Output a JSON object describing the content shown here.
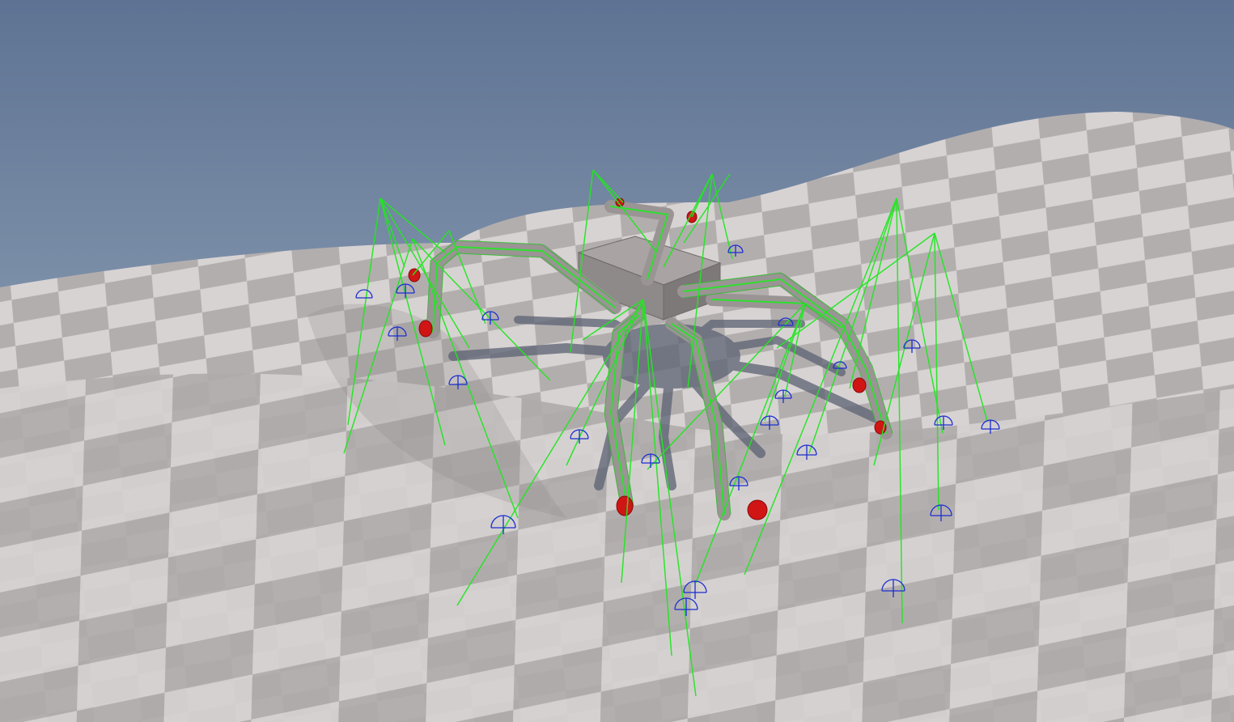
{
  "scene": {
    "kind": "3d-viewport",
    "subject": "spider-robot-ik-debug",
    "leg_count": 8,
    "colors": {
      "sky_top": "#5e7393",
      "sky_bottom": "#a8b8c8",
      "ground_light": "#d8d3d3",
      "ground_dark": "#b3aeae",
      "shadow": "#5b6272",
      "body": "#9a9494",
      "gizmo_ray": "#22e622",
      "ik_target": "#d01515",
      "raycast_sphere": "#1a2fd0"
    },
    "icons": [
      "spider-body",
      "spider-leg",
      "ik-target-marker",
      "raycast-hit-gizmo",
      "ik-ray-line"
    ]
  }
}
